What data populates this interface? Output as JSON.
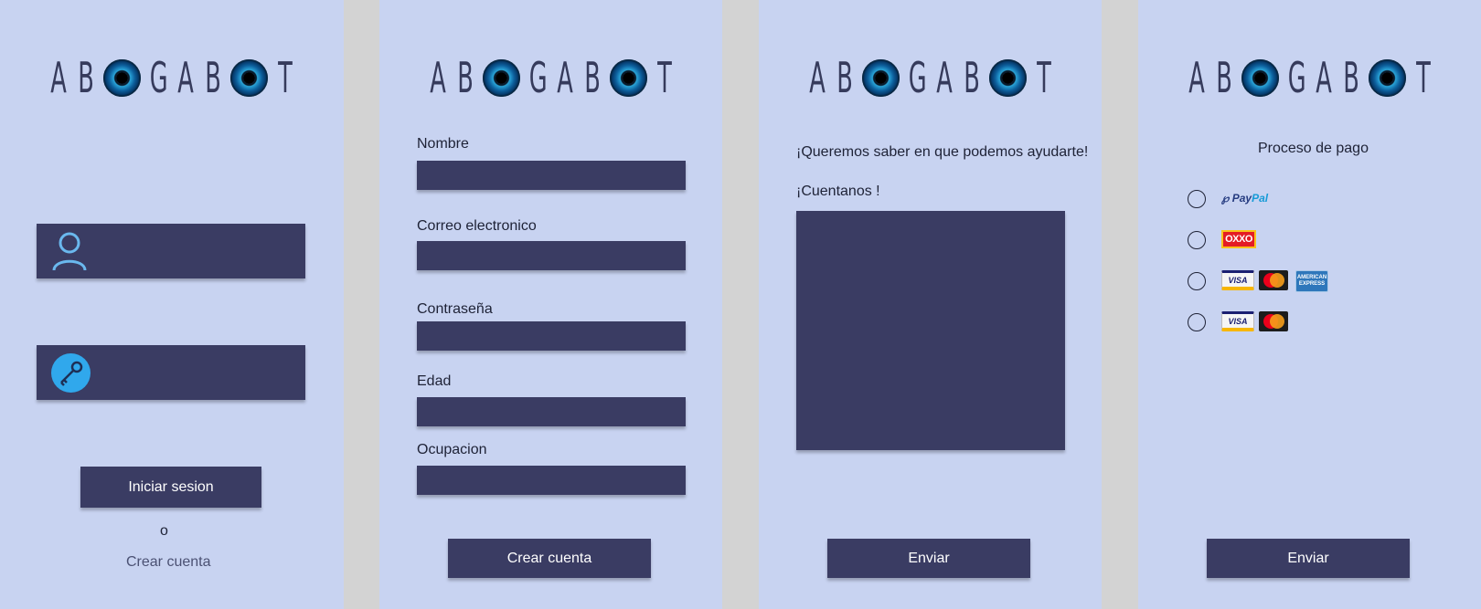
{
  "logo": {
    "letters_before": [
      "A",
      "B"
    ],
    "letters_middle": [
      "G",
      "A",
      "B"
    ],
    "letters_after": [
      "T"
    ]
  },
  "login": {
    "user_icon": "user-icon",
    "key_icon": "key-icon",
    "login_button": "Iniciar sesion",
    "or_text": "o",
    "create_account_link": "Crear cuenta"
  },
  "register": {
    "fields": [
      {
        "label": "Nombre"
      },
      {
        "label": "Correo electronico"
      },
      {
        "label": "Contraseña"
      },
      {
        "label": "Edad"
      },
      {
        "label": "Ocupacion"
      }
    ],
    "submit_button": "Crear cuenta"
  },
  "message": {
    "heading": "¡Queremos saber en que podemos ayudarte!",
    "prompt": "¡Cuentanos !",
    "submit_button": "Enviar"
  },
  "payment": {
    "title": "Proceso de pago",
    "options": [
      {
        "name": "paypal",
        "text_pay": "Pay",
        "text_pal": "Pal"
      },
      {
        "name": "oxxo",
        "text": "OXXO"
      },
      {
        "name": "visa-mastercard-amex",
        "visa": "VISA",
        "amex": "AMERICAN EXPRESS"
      },
      {
        "name": "visa-mastercard",
        "visa": "VISA"
      }
    ],
    "submit_button": "Enviar"
  },
  "colors": {
    "panel_bg": "#c8d3f1",
    "dark": "#3a3c63",
    "gap": "#d3d3d3",
    "icon_blue": "#30a8ec"
  }
}
